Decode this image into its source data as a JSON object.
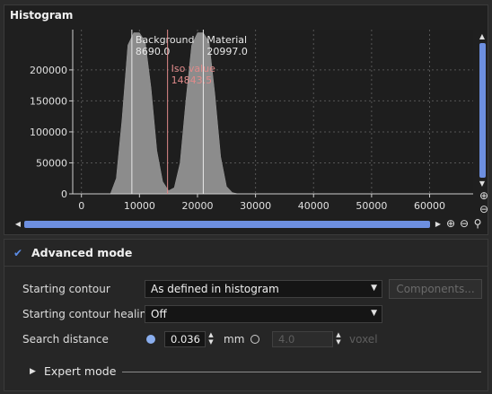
{
  "histogram": {
    "title": "Histogram",
    "chart_data": {
      "type": "area",
      "x_ticks": [
        0,
        10000,
        20000,
        30000,
        40000,
        50000,
        60000
      ],
      "x_tick_labels": [
        "0",
        "10000",
        "20000",
        "30000",
        "40000",
        "50000",
        "60000"
      ],
      "y_ticks": [
        0,
        50000,
        100000,
        150000,
        200000
      ],
      "y_tick_labels": [
        "0",
        "50000",
        "100000",
        "150000",
        "200000"
      ],
      "xlim": [
        -1500,
        67500
      ],
      "ylim": [
        0,
        265000
      ],
      "grid": true,
      "x": [
        0,
        5000,
        6000,
        7000,
        8000,
        9000,
        10000,
        11000,
        12000,
        13000,
        14000,
        15000,
        16000,
        17000,
        18000,
        19000,
        20000,
        21000,
        22000,
        23000,
        24000,
        25000,
        26000,
        27000,
        28000,
        35000,
        65000
      ],
      "y": [
        0,
        0,
        25000,
        120000,
        240000,
        260000,
        260000,
        245000,
        170000,
        70000,
        20000,
        5000,
        10000,
        50000,
        150000,
        240000,
        260000,
        260000,
        245000,
        160000,
        60000,
        12000,
        2000,
        0,
        0,
        0,
        0
      ],
      "markers": [
        {
          "name": "Background",
          "value_label": "8690.0",
          "x": 8690.0,
          "color": "#e8e8e8"
        },
        {
          "name": "Iso value",
          "value_label": "14843.5",
          "x": 14843.5,
          "color": "#e08a8a"
        },
        {
          "name": "Material",
          "value_label": "20997.0",
          "x": 20997.0,
          "color": "#e8e8e8"
        }
      ],
      "fill_color": "#8c8c8c",
      "plot_bg": "#1e1e1e"
    },
    "zoom_icons": [
      "zoom-in",
      "zoom-out",
      "zoom-reset"
    ]
  },
  "advanced": {
    "title": "Advanced mode",
    "checked": true,
    "starting_contour": {
      "label": "Starting contour",
      "value": "As defined in histogram"
    },
    "components_button": "Components...",
    "healing": {
      "label": "Starting contour healing",
      "value": "Off"
    },
    "search": {
      "label": "Search distance",
      "mm_value": "0.036",
      "mm_unit": "mm",
      "voxel_value": "4.0",
      "voxel_unit": "voxel"
    },
    "expert": {
      "label": "Expert mode"
    }
  }
}
